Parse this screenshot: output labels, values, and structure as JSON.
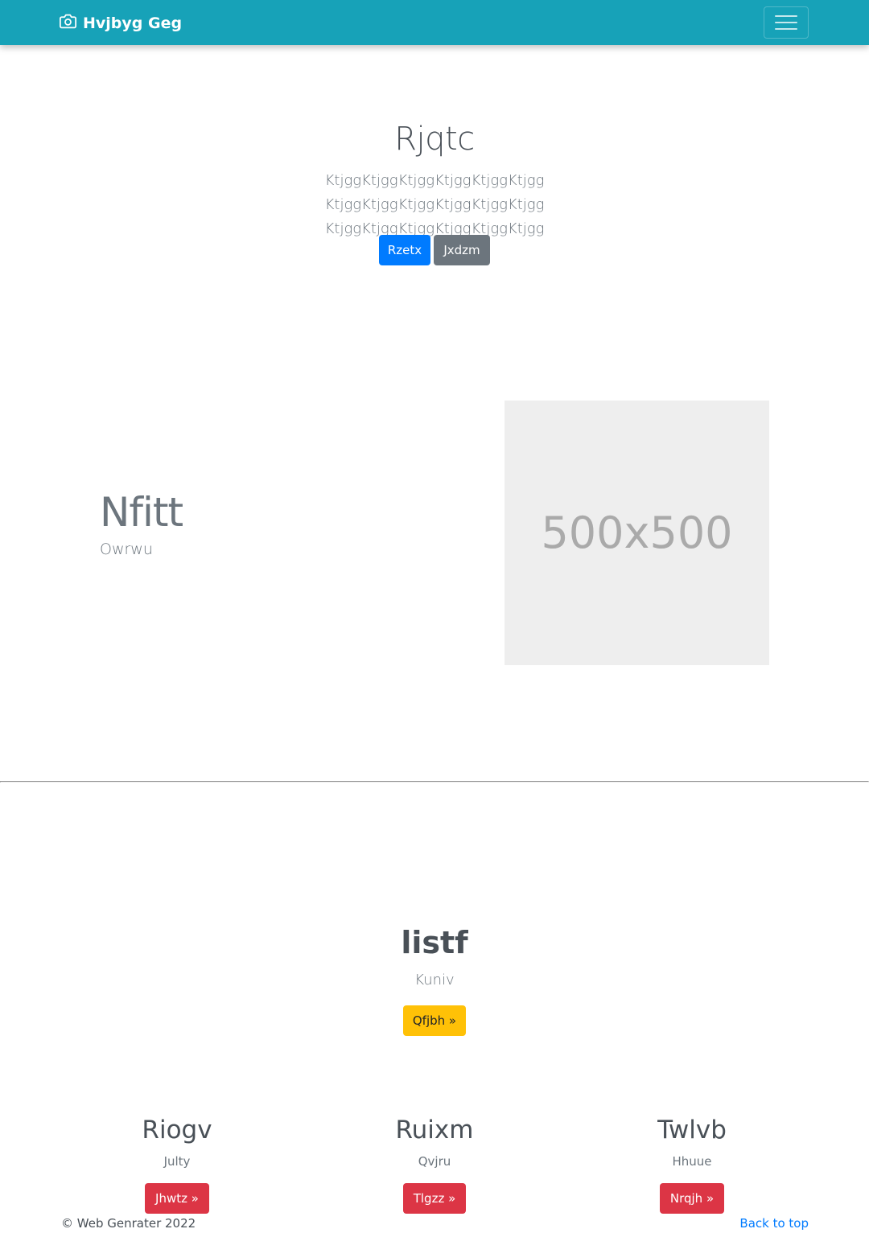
{
  "navbar": {
    "brand": "Hvjbyg Geg",
    "brand_icon": "camera-icon",
    "toggler_icon": "hamburger-menu-icon",
    "background": "#17a2b8"
  },
  "hero": {
    "title": "Rjqtc",
    "lead": "KtjggKtjggKtjggKtjggKtjggKtjgg KtjggKtjggKtjggKtjggKtjggKtjgg KtjggKtjggKtjggKtjggKtjggKtjgg",
    "primary_button": "Rzetx",
    "secondary_button": "Jxdzm"
  },
  "feature": {
    "heading": "Nfitt",
    "subheading": "Owrwu",
    "image_placeholder": "500x500"
  },
  "list_section": {
    "title": "listf",
    "subtitle": "Kuniv",
    "button": "Qfjbh »"
  },
  "columns": [
    {
      "title": "Riogv",
      "text": "Julty",
      "button": "Jhwtz »"
    },
    {
      "title": "Ruixm",
      "text": "Qvjru",
      "button": "Tlgzz »"
    },
    {
      "title": "Twlvb",
      "text": "Hhuue",
      "button": "Nrqjh »"
    }
  ],
  "footer": {
    "copyright": "© Web Genrater 2022",
    "back_to_top": "Back to top"
  },
  "colors": {
    "primary": "#007bff",
    "secondary": "#6c757d",
    "warning": "#ffc107",
    "danger": "#dc3545"
  }
}
